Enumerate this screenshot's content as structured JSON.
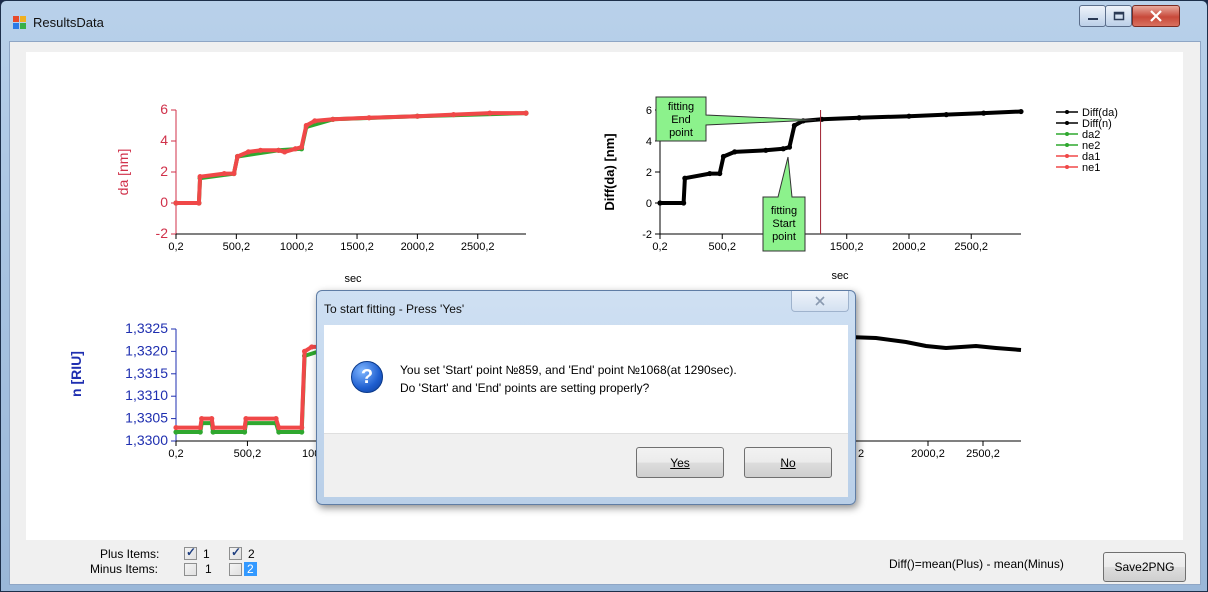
{
  "window": {
    "title": "ResultsData"
  },
  "charts": {
    "top_left": {
      "ylabel": "da [nm]",
      "xlabel": "sec",
      "yticks": [
        "-2",
        "0",
        "2",
        "4",
        "6"
      ],
      "xticks": [
        "0,2",
        "500,2",
        "1000,2",
        "1500,2",
        "2000,2",
        "2500,2"
      ]
    },
    "top_right": {
      "ylabel": "Diff(da) [nm]",
      "xlabel": "sec",
      "yticks": [
        "-2",
        "0",
        "2",
        "4",
        "6"
      ],
      "xticks": [
        "0,2",
        "500,2",
        "1000,2",
        "1500,2",
        "2000,2",
        "2500,2"
      ],
      "callout_end": [
        "fitting",
        "End",
        "point"
      ],
      "callout_start": [
        "fitting",
        "Start",
        "point"
      ]
    },
    "bottom_left": {
      "ylabel": "n [RIU]",
      "yticks": [
        "1,3300",
        "1,3305",
        "1,3310",
        "1,3315",
        "1,3320",
        "1,3325"
      ],
      "xticks": [
        "0,2",
        "500,2",
        "1000,2"
      ]
    },
    "bottom_right": {
      "xticks": [
        "2000,2",
        "2500,2"
      ],
      "partial_tick": "2"
    }
  },
  "legend": [
    {
      "name": "Diff(da)",
      "color": "#000000"
    },
    {
      "name": "Diff(n)",
      "color": "#000000"
    },
    {
      "name": "da2",
      "color": "#2fa82f"
    },
    {
      "name": "ne2",
      "color": "#2fa82f"
    },
    {
      "name": "da1",
      "color": "#f04848"
    },
    {
      "name": "ne1",
      "color": "#f04848"
    }
  ],
  "chart_data": [
    {
      "type": "line",
      "ylabel": "da [nm]",
      "xlabel": "sec",
      "ylim": [
        -2,
        7
      ],
      "xlim": [
        0.2,
        2900
      ],
      "series": [
        {
          "name": "da1",
          "points": [
            [
              0.2,
              0
            ],
            [
              190,
              0
            ],
            [
              200,
              1.7
            ],
            [
              400,
              1.9
            ],
            [
              480,
              1.9
            ],
            [
              510,
              3.0
            ],
            [
              600,
              3.3
            ],
            [
              700,
              3.4
            ],
            [
              850,
              3.4
            ],
            [
              900,
              3.3
            ],
            [
              990,
              3.5
            ],
            [
              1040,
              3.6
            ],
            [
              1080,
              5.0
            ],
            [
              1150,
              5.3
            ],
            [
              1300,
              5.4
            ],
            [
              1600,
              5.5
            ],
            [
              2000,
              5.6
            ],
            [
              2300,
              5.7
            ],
            [
              2600,
              5.8
            ],
            [
              2900,
              5.8
            ]
          ]
        },
        {
          "name": "da2",
          "points": [
            [
              0.2,
              0
            ],
            [
              190,
              0
            ],
            [
              200,
              1.6
            ],
            [
              480,
              1.9
            ],
            [
              510,
              3.0
            ],
            [
              850,
              3.4
            ],
            [
              1040,
              3.5
            ],
            [
              1080,
              4.9
            ],
            [
              1300,
              5.4
            ],
            [
              2000,
              5.6
            ],
            [
              2900,
              5.8
            ]
          ]
        }
      ]
    },
    {
      "type": "line",
      "ylabel": "Diff(da) [nm]",
      "xlabel": "sec",
      "ylim": [
        -2,
        7
      ],
      "xlim": [
        0.2,
        2900
      ],
      "series": [
        {
          "name": "Diff(da)",
          "points": [
            [
              0.2,
              0
            ],
            [
              190,
              0
            ],
            [
              200,
              1.6
            ],
            [
              400,
              1.9
            ],
            [
              480,
              1.9
            ],
            [
              510,
              3.0
            ],
            [
              600,
              3.3
            ],
            [
              850,
              3.4
            ],
            [
              990,
              3.5
            ],
            [
              1040,
              3.6
            ],
            [
              1080,
              5.0
            ],
            [
              1150,
              5.3
            ],
            [
              1300,
              5.4
            ],
            [
              1600,
              5.5
            ],
            [
              2000,
              5.6
            ],
            [
              2300,
              5.7
            ],
            [
              2600,
              5.8
            ],
            [
              2900,
              5.9
            ]
          ]
        }
      ],
      "markers": {
        "end_time": 1290
      }
    },
    {
      "type": "line",
      "ylabel": "n [RIU]",
      "ylim": [
        1.33,
        1.3325
      ],
      "xlim": [
        0.2,
        1000
      ],
      "series": [
        {
          "name": "ne1",
          "points": [
            [
              0.2,
              1.3303
            ],
            [
              170,
              1.3303
            ],
            [
              180,
              1.3305
            ],
            [
              250,
              1.3305
            ],
            [
              260,
              1.3303
            ],
            [
              480,
              1.3303
            ],
            [
              490,
              1.3305
            ],
            [
              700,
              1.3305
            ],
            [
              720,
              1.3303
            ],
            [
              880,
              1.3303
            ],
            [
              900,
              1.332
            ],
            [
              950,
              1.3321
            ],
            [
              1000,
              1.3321
            ]
          ]
        },
        {
          "name": "ne2",
          "points": [
            [
              0.2,
              1.3302
            ],
            [
              170,
              1.3302
            ],
            [
              180,
              1.3304
            ],
            [
              250,
              1.3304
            ],
            [
              260,
              1.3302
            ],
            [
              480,
              1.3302
            ],
            [
              490,
              1.3304
            ],
            [
              700,
              1.3304
            ],
            [
              720,
              1.3302
            ],
            [
              880,
              1.3302
            ],
            [
              900,
              1.3319
            ],
            [
              1000,
              1.332
            ]
          ]
        }
      ]
    }
  ],
  "dialog": {
    "title": "To start fitting - Press 'Yes'",
    "line1": "You set 'Start' point №859, and 'End' point №1068(at 1290sec).",
    "line2": "Do 'Start' and 'End' points are setting properly?",
    "yes_label": "Yes",
    "no_label": "No",
    "icon": "question-icon"
  },
  "bottom": {
    "plus_label": "Plus Items:",
    "minus_label": "Minus Items:",
    "plus_items": [
      {
        "label": "1",
        "checked": true
      },
      {
        "label": "2",
        "checked": true
      }
    ],
    "minus_items": [
      {
        "label": "1",
        "checked": false
      },
      {
        "label": "2",
        "checked": false,
        "selected": true
      }
    ],
    "formula": "Diff()=mean(Plus) - mean(Minus)",
    "save_label": "Save2PNG"
  }
}
